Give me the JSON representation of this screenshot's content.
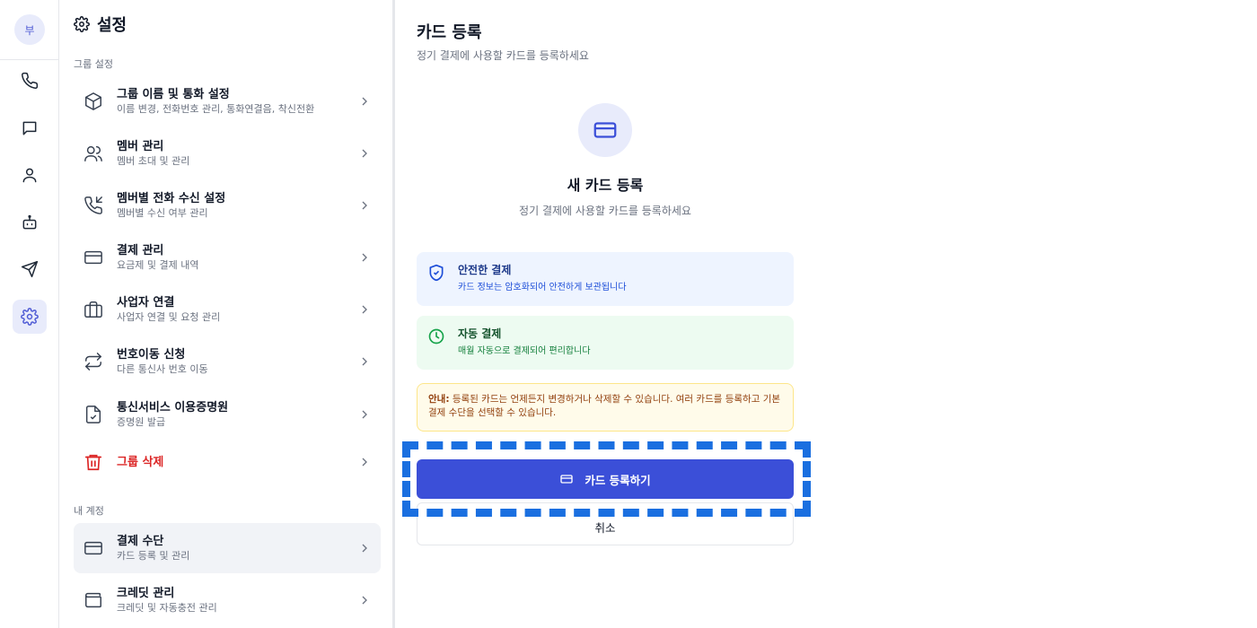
{
  "rail": {
    "avatar": "부",
    "icons": [
      "phone-icon",
      "chat-icon",
      "user-icon",
      "bot-icon",
      "send-icon",
      "gear-icon"
    ],
    "active": "gear-icon"
  },
  "settings": {
    "title": "설정",
    "group_section": "그룹 설정",
    "account_section": "내 계정",
    "items": [
      {
        "title": "그룹 이름 및 통화 설정",
        "subtitle": "이름 변경, 전화번호 관리, 통화연결음, 착신전환",
        "icon": "box-icon"
      },
      {
        "title": "멤버 관리",
        "subtitle": "멤버 초대 및 관리",
        "icon": "users-icon"
      },
      {
        "title": "멤버별 전화 수신 설정",
        "subtitle": "멤버별 수신 여부 관리",
        "icon": "phone-incoming-icon"
      },
      {
        "title": "결제 관리",
        "subtitle": "요금제 및 결제 내역",
        "icon": "credit-card-icon"
      },
      {
        "title": "사업자 연결",
        "subtitle": "사업자 연결 및 요청 관리",
        "icon": "briefcase-icon"
      },
      {
        "title": "번호이동 신청",
        "subtitle": "다른 통신사 번호 이동",
        "icon": "transfer-icon"
      },
      {
        "title": "통신서비스 이용증명원",
        "subtitle": "증명원 발급",
        "icon": "document-check-icon"
      },
      {
        "title": "그룹 삭제",
        "subtitle": "",
        "icon": "trash-icon"
      }
    ],
    "account_items": [
      {
        "title": "결제 수단",
        "subtitle": "카드 등록 및 관리",
        "icon": "credit-card-icon"
      },
      {
        "title": "크레딧 관리",
        "subtitle": "크레딧 및 자동충전 관리",
        "icon": "wallet-icon"
      }
    ]
  },
  "main": {
    "title": "카드 등록",
    "subtitle": "정기 결제에 사용할 카드를 등록하세요",
    "hero_title": "새 카드 등록",
    "hero_subtitle": "정기 결제에 사용할 카드를 등록하세요",
    "secure": {
      "title": "안전한 결제",
      "desc": "카드 정보는 암호화되어 안전하게 보관됩니다"
    },
    "auto": {
      "title": "자동 결제",
      "desc": "매월 자동으로 결제되어 편리합니다"
    },
    "notice_label": "안내:",
    "notice_text": " 등록된 카드는 언제든지 변경하거나 삭제할 수 있습니다. 여러 카드를 등록하고 기본 결제 수단을 선택할 수 있습니다.",
    "register_button": "카드 등록하기",
    "cancel_button": "취소"
  },
  "colors": {
    "accent": "#3b4fd8",
    "highlight": "#1a6fe0",
    "danger": "#dc2626"
  }
}
